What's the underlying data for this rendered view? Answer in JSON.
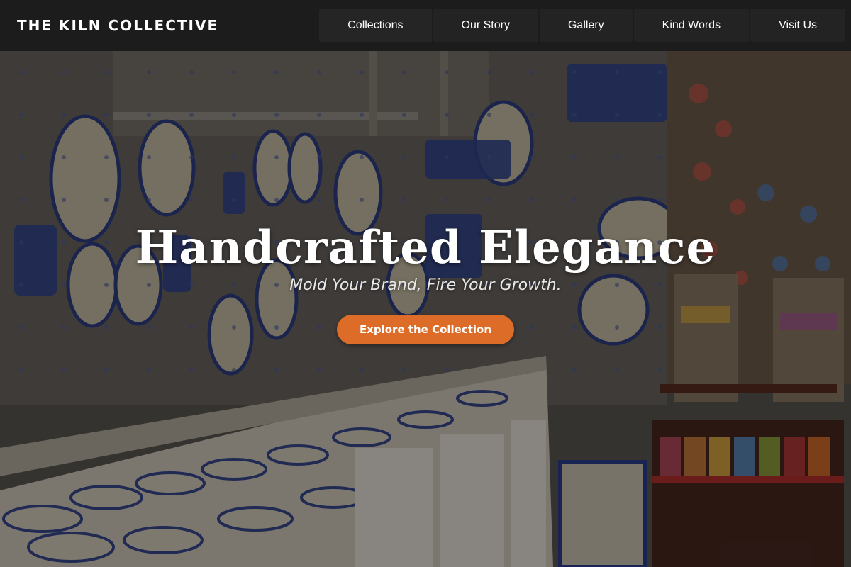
{
  "site": {
    "brand": "THE KILN COLLECTIVE"
  },
  "nav": {
    "items": [
      {
        "label": "Collections"
      },
      {
        "label": "Our Story"
      },
      {
        "label": "Gallery"
      },
      {
        "label": "Kind Words"
      },
      {
        "label": "Visit Us"
      }
    ]
  },
  "hero": {
    "title": "Handcrafted Elegance",
    "subtitle": "Mold Your Brand, Fire Your Growth.",
    "cta_label": "Explore the Collection",
    "background_image": "ceramics-shop-photo",
    "overlay_color": "#000000"
  },
  "colors": {
    "nav_background": "#1c1c1c",
    "accent": "#dc6c27",
    "text": "#ffffff"
  }
}
